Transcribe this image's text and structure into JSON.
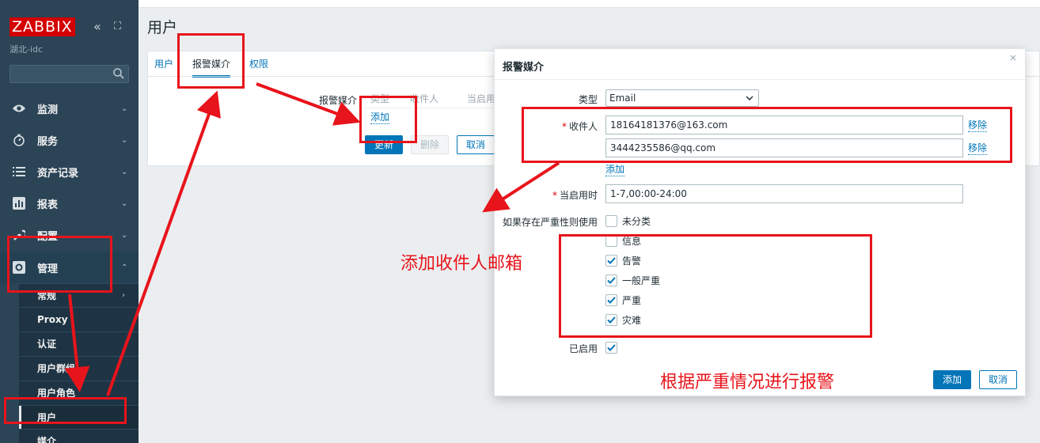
{
  "sidebar": {
    "logo": "ZABBIX",
    "collapse_icon": "«",
    "kiosk_icon": "⛶",
    "server_name": "湖北-idc",
    "search_placeholder": "",
    "menu": [
      {
        "label": "监测",
        "icon": "eye-icon"
      },
      {
        "label": "服务",
        "icon": "clock-icon"
      },
      {
        "label": "资产记录",
        "icon": "list-icon"
      },
      {
        "label": "报表",
        "icon": "bar-chart-icon"
      },
      {
        "label": "配置",
        "icon": "wrench-icon"
      },
      {
        "label": "管理",
        "icon": "gear-icon"
      }
    ],
    "submenu": [
      {
        "label": "常规"
      },
      {
        "label": "Proxy"
      },
      {
        "label": "认证"
      },
      {
        "label": "用户群组"
      },
      {
        "label": "用户角色"
      },
      {
        "label": "用户"
      },
      {
        "label": "媒介"
      }
    ]
  },
  "page": {
    "title": "用户",
    "tabs": [
      {
        "label": "用户"
      },
      {
        "label": "报警媒介"
      },
      {
        "label": "权限"
      }
    ],
    "media_label": "报警媒介",
    "media_columns": [
      "类型",
      "收件人",
      "当启用时"
    ],
    "add_link": "添加",
    "buttons": {
      "update": "更新",
      "delete": "删除",
      "cancel": "取消"
    }
  },
  "dialog": {
    "title": "报警媒介",
    "close": "×",
    "type_label": "类型",
    "type_value": "Email",
    "recipient_label": "收件人",
    "recipients": [
      "18164181376@163.com",
      "3444235586@qq.com"
    ],
    "remove_label": "移除",
    "add_link": "添加",
    "when_active_label": "当启用时",
    "when_active_value": "1-7,00:00-24:00",
    "severity_label": "如果存在严重性则使用",
    "severities": [
      {
        "label": "未分类",
        "checked": false
      },
      {
        "label": "信息",
        "checked": false
      },
      {
        "label": "告警",
        "checked": true
      },
      {
        "label": "一般严重",
        "checked": true
      },
      {
        "label": "严重",
        "checked": true
      },
      {
        "label": "灾难",
        "checked": true
      }
    ],
    "enabled_label": "已启用",
    "enabled_checked": true,
    "buttons": {
      "add": "添加",
      "cancel": "取消"
    }
  },
  "annotations": {
    "recipient_note": "添加收件人邮箱",
    "severity_note": "根据严重情况进行报警",
    "color": "#e8141b"
  }
}
